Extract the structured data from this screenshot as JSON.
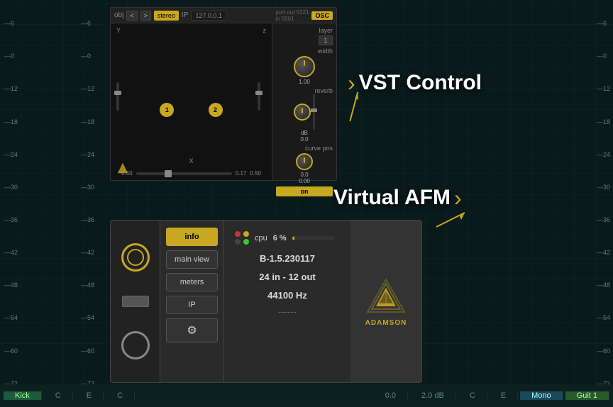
{
  "app": {
    "title": "VST Control / Virtual AFM"
  },
  "background": {
    "color": "#0a1a1a"
  },
  "scale_labels": {
    "values": [
      "-6",
      "-0",
      "-12",
      "-18",
      "-24",
      "-30",
      "-36",
      "-42",
      "-48",
      "-54",
      "-60",
      "-72"
    ]
  },
  "vst": {
    "toolbar": {
      "obj_label": "obj",
      "prev_label": "<",
      "next_label": ">",
      "stereo_label": "stereo",
      "ip_value": "127.0.0.1",
      "port_out": "port out 5321",
      "port_in": "in 5001",
      "osc_label": "OSC"
    },
    "xy": {
      "y_label": "Y",
      "z_label": "z",
      "x_label": "X",
      "pos_left": "0.50",
      "pos_right": "0.50",
      "pos_x": "0.17",
      "source1": "1",
      "source2": "2"
    },
    "right": {
      "layer_label": "layer",
      "layer_value": "1",
      "width_label": "width",
      "width_value": "1.00",
      "reverb_label": "reverb",
      "reverb_db": "dB",
      "reverb_value": "0.0",
      "curve_pos_label": "curve pos",
      "curve_pos_value": "0.0",
      "curve_value2": "0.00",
      "on_label": "on"
    }
  },
  "labels": {
    "vst_control": "VST Control",
    "virtual_afm": "Virtual AFM",
    "arrow": "›"
  },
  "afm": {
    "nav": {
      "info": "info",
      "main_view": "main view",
      "meters": "meters",
      "ip": "IP",
      "settings_icon": "gear"
    },
    "status": {
      "cpu_label": "cpu",
      "cpu_value": "6 %",
      "cpu_percent": 6
    },
    "info": {
      "version": "B-1.5.230117",
      "channels": "24 in - 12 out",
      "sample_rate": "44100 Hz",
      "extra": "------"
    },
    "logo": {
      "text": "ADAMSON"
    }
  },
  "bottom_bar": {
    "tabs": [
      {
        "label": "Kick",
        "type": "green"
      },
      {
        "label": "C",
        "type": "dark"
      },
      {
        "label": "E",
        "type": "dark"
      },
      {
        "label": "C",
        "type": "dark"
      },
      {
        "label": "0.0",
        "type": "dark"
      },
      {
        "label": "2.0 dB",
        "type": "dark"
      },
      {
        "label": "C",
        "type": "dark"
      },
      {
        "label": "E",
        "type": "dark"
      },
      {
        "label": "Mono",
        "type": "mono"
      },
      {
        "label": "Guit 1",
        "type": "guit"
      }
    ]
  }
}
